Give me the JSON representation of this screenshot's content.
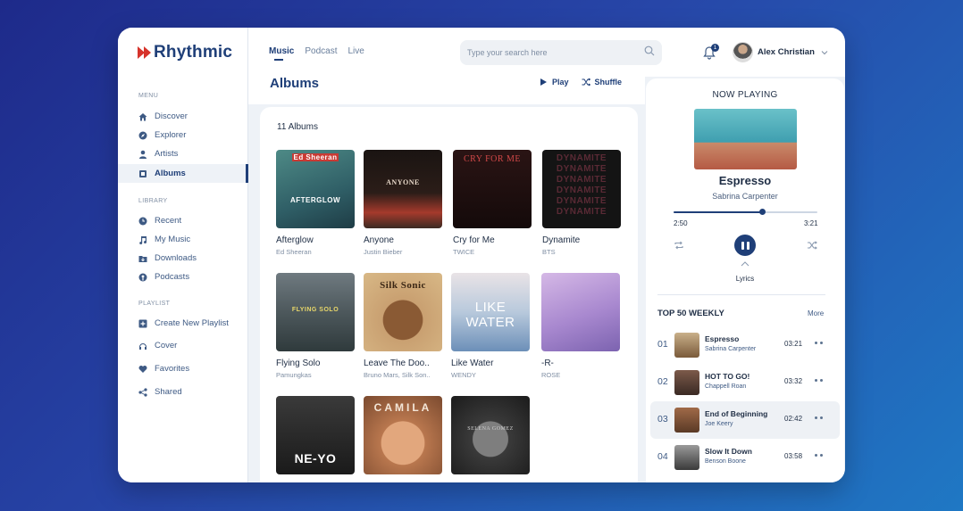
{
  "app": {
    "name": "Rhythmic"
  },
  "sidebar": {
    "menu_title": "MENU",
    "menu": [
      {
        "label": "Discover",
        "icon": "home-icon"
      },
      {
        "label": "Explorer",
        "icon": "compass-icon"
      },
      {
        "label": "Artists",
        "icon": "person-icon"
      },
      {
        "label": "Albums",
        "icon": "album-icon",
        "active": true
      }
    ],
    "library_title": "LIBRARY",
    "library": [
      {
        "label": "Recent",
        "icon": "clock-icon"
      },
      {
        "label": "My Music",
        "icon": "music-note-icon"
      },
      {
        "label": "Downloads",
        "icon": "folder-download-icon"
      },
      {
        "label": "Podcasts",
        "icon": "podcast-icon"
      }
    ],
    "playlist_title": "PLAYLIST",
    "playlist": [
      {
        "label": "Create New Playlist",
        "icon": "plus-square-icon"
      },
      {
        "label": "Cover",
        "icon": "headphones-icon"
      },
      {
        "label": "Favorites",
        "icon": "heart-icon"
      },
      {
        "label": "Shared",
        "icon": "share-icon"
      }
    ]
  },
  "topbar": {
    "tabs": [
      {
        "label": "Music",
        "active": true
      },
      {
        "label": "Podcast"
      },
      {
        "label": "Live"
      }
    ],
    "search_placeholder": "Type your search here",
    "notification_count": "1",
    "user_name": "Alex Christian"
  },
  "main": {
    "title": "Albums",
    "play_label": "Play",
    "shuffle_label": "Shuffle",
    "count_label": "11 Albums",
    "albums": [
      {
        "title": "Afterglow",
        "artist": "Ed Sheeran",
        "cover_text": "Ed Sheeran",
        "cover_sub": "AFTERGLOW"
      },
      {
        "title": "Anyone",
        "artist": "Justin Bieber",
        "cover_text": "ANYONE"
      },
      {
        "title": "Cry for Me",
        "artist": "TWICE",
        "cover_text": "CRY FOR ME"
      },
      {
        "title": "Dynamite",
        "artist": "BTS",
        "cover_text": "DYNAMITE"
      },
      {
        "title": "Flying Solo",
        "artist": "Pamungkas",
        "cover_text": "FLYING SOLO"
      },
      {
        "title": "Leave The Doo..",
        "artist": "Bruno Mars, Silk Son..",
        "cover_text": "Silk Sonic"
      },
      {
        "title": "Like Water",
        "artist": "WENDY",
        "cover_text": "LIKE WATER"
      },
      {
        "title": "-R-",
        "artist": "ROSE",
        "cover_text": ""
      },
      {
        "title": "",
        "artist": "",
        "cover_text": "NE-YO"
      },
      {
        "title": "",
        "artist": "",
        "cover_text": "CAMILA"
      },
      {
        "title": "",
        "artist": "",
        "cover_text": "SELENA GOMEZ"
      }
    ]
  },
  "now_playing": {
    "heading": "NOW PLAYING",
    "song": "Espresso",
    "artist": "Sabrina Carpenter",
    "current_time": "2:50",
    "total_time": "3:21",
    "progress": 0.62,
    "lyrics_label": "Lyrics",
    "top_title": "TOP 50 WEEKLY",
    "more_label": "More",
    "tracks": [
      {
        "num": "01",
        "title": "Espresso",
        "artist": "Sabrina Carpenter",
        "duration": "03:21"
      },
      {
        "num": "02",
        "title": "HOT TO GO!",
        "artist": "Chappell Roan",
        "duration": "03:32"
      },
      {
        "num": "03",
        "title": "End of Beginning",
        "artist": "Joe Keery",
        "duration": "02:42",
        "active": true
      },
      {
        "num": "04",
        "title": "Slow It Down",
        "artist": "Benson Boone",
        "duration": "03:58"
      }
    ]
  }
}
